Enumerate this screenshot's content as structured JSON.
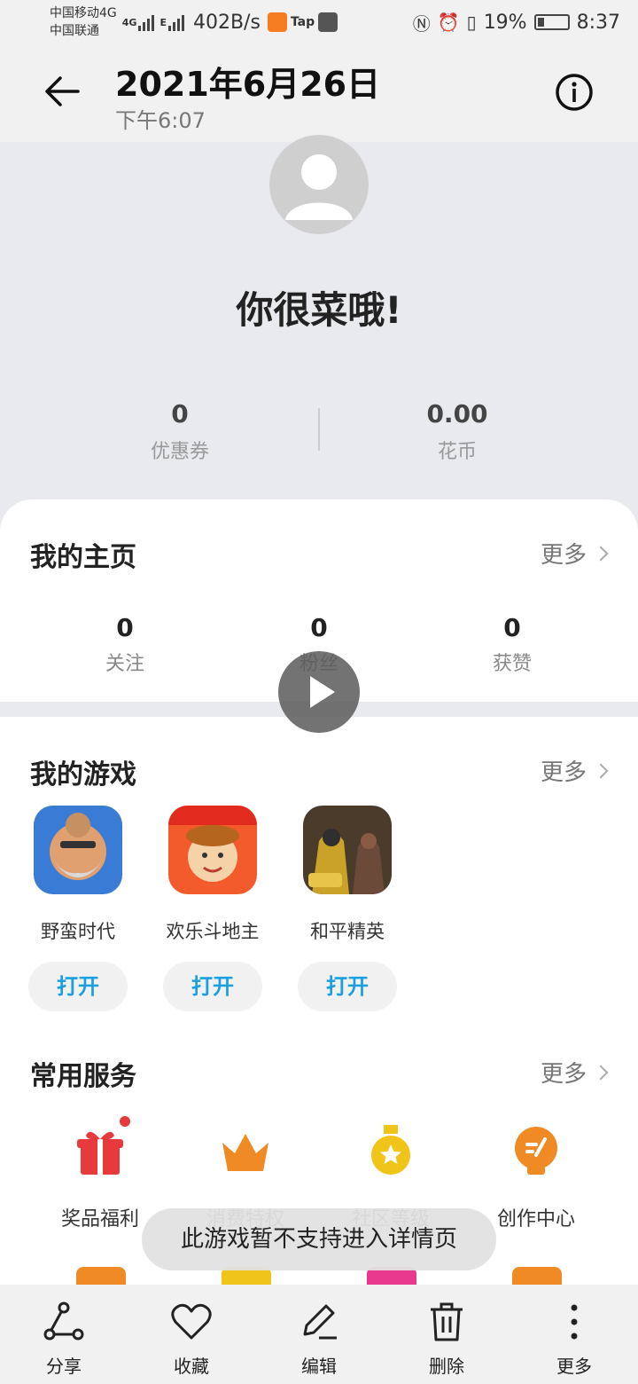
{
  "status_bar": {
    "carrier1": "中国移动4G",
    "carrier2": "中国联通",
    "net_type1": "4G",
    "net_type2": "E",
    "speed": "402B/s",
    "tap_label": "Tap",
    "battery": "19%",
    "time": "8:37"
  },
  "header": {
    "date": "2021年6月26日",
    "time": "下午6:07"
  },
  "profile": {
    "nickname": "你很菜哦!",
    "coupons_value": "0",
    "coupons_label": "优惠券",
    "coins_value": "0.00",
    "coins_label": "花币"
  },
  "homepage": {
    "title": "我的主页",
    "more": "更多",
    "stats": [
      {
        "value": "0",
        "label": "关注"
      },
      {
        "value": "0",
        "label": "粉丝"
      },
      {
        "value": "0",
        "label": "获赞"
      }
    ]
  },
  "games": {
    "title": "我的游戏",
    "more": "更多",
    "items": [
      {
        "name": "野蛮时代",
        "action": "打开"
      },
      {
        "name": "欢乐斗地主",
        "action": "打开"
      },
      {
        "name": "和平精英",
        "action": "打开"
      }
    ]
  },
  "services": {
    "title": "常用服务",
    "more": "更多",
    "items": [
      {
        "label": "奖品福利",
        "icon": "gift-icon"
      },
      {
        "label": "消费特权",
        "icon": "crown-icon"
      },
      {
        "label": "社区等级",
        "icon": "medal-icon"
      },
      {
        "label": "创作中心",
        "icon": "bulb-icon"
      }
    ]
  },
  "toast": "此游戏暂不支持进入详情页",
  "bottom_bar": [
    {
      "label": "分享",
      "icon": "share-icon"
    },
    {
      "label": "收藏",
      "icon": "heart-icon"
    },
    {
      "label": "编辑",
      "icon": "edit-icon"
    },
    {
      "label": "删除",
      "icon": "trash-icon"
    },
    {
      "label": "更多",
      "icon": "more-vertical-icon"
    }
  ],
  "colors": {
    "accent": "#1a9fe0",
    "service_red": "#e8393c",
    "service_orange": "#f08a24",
    "service_gold": "#f0c419"
  }
}
